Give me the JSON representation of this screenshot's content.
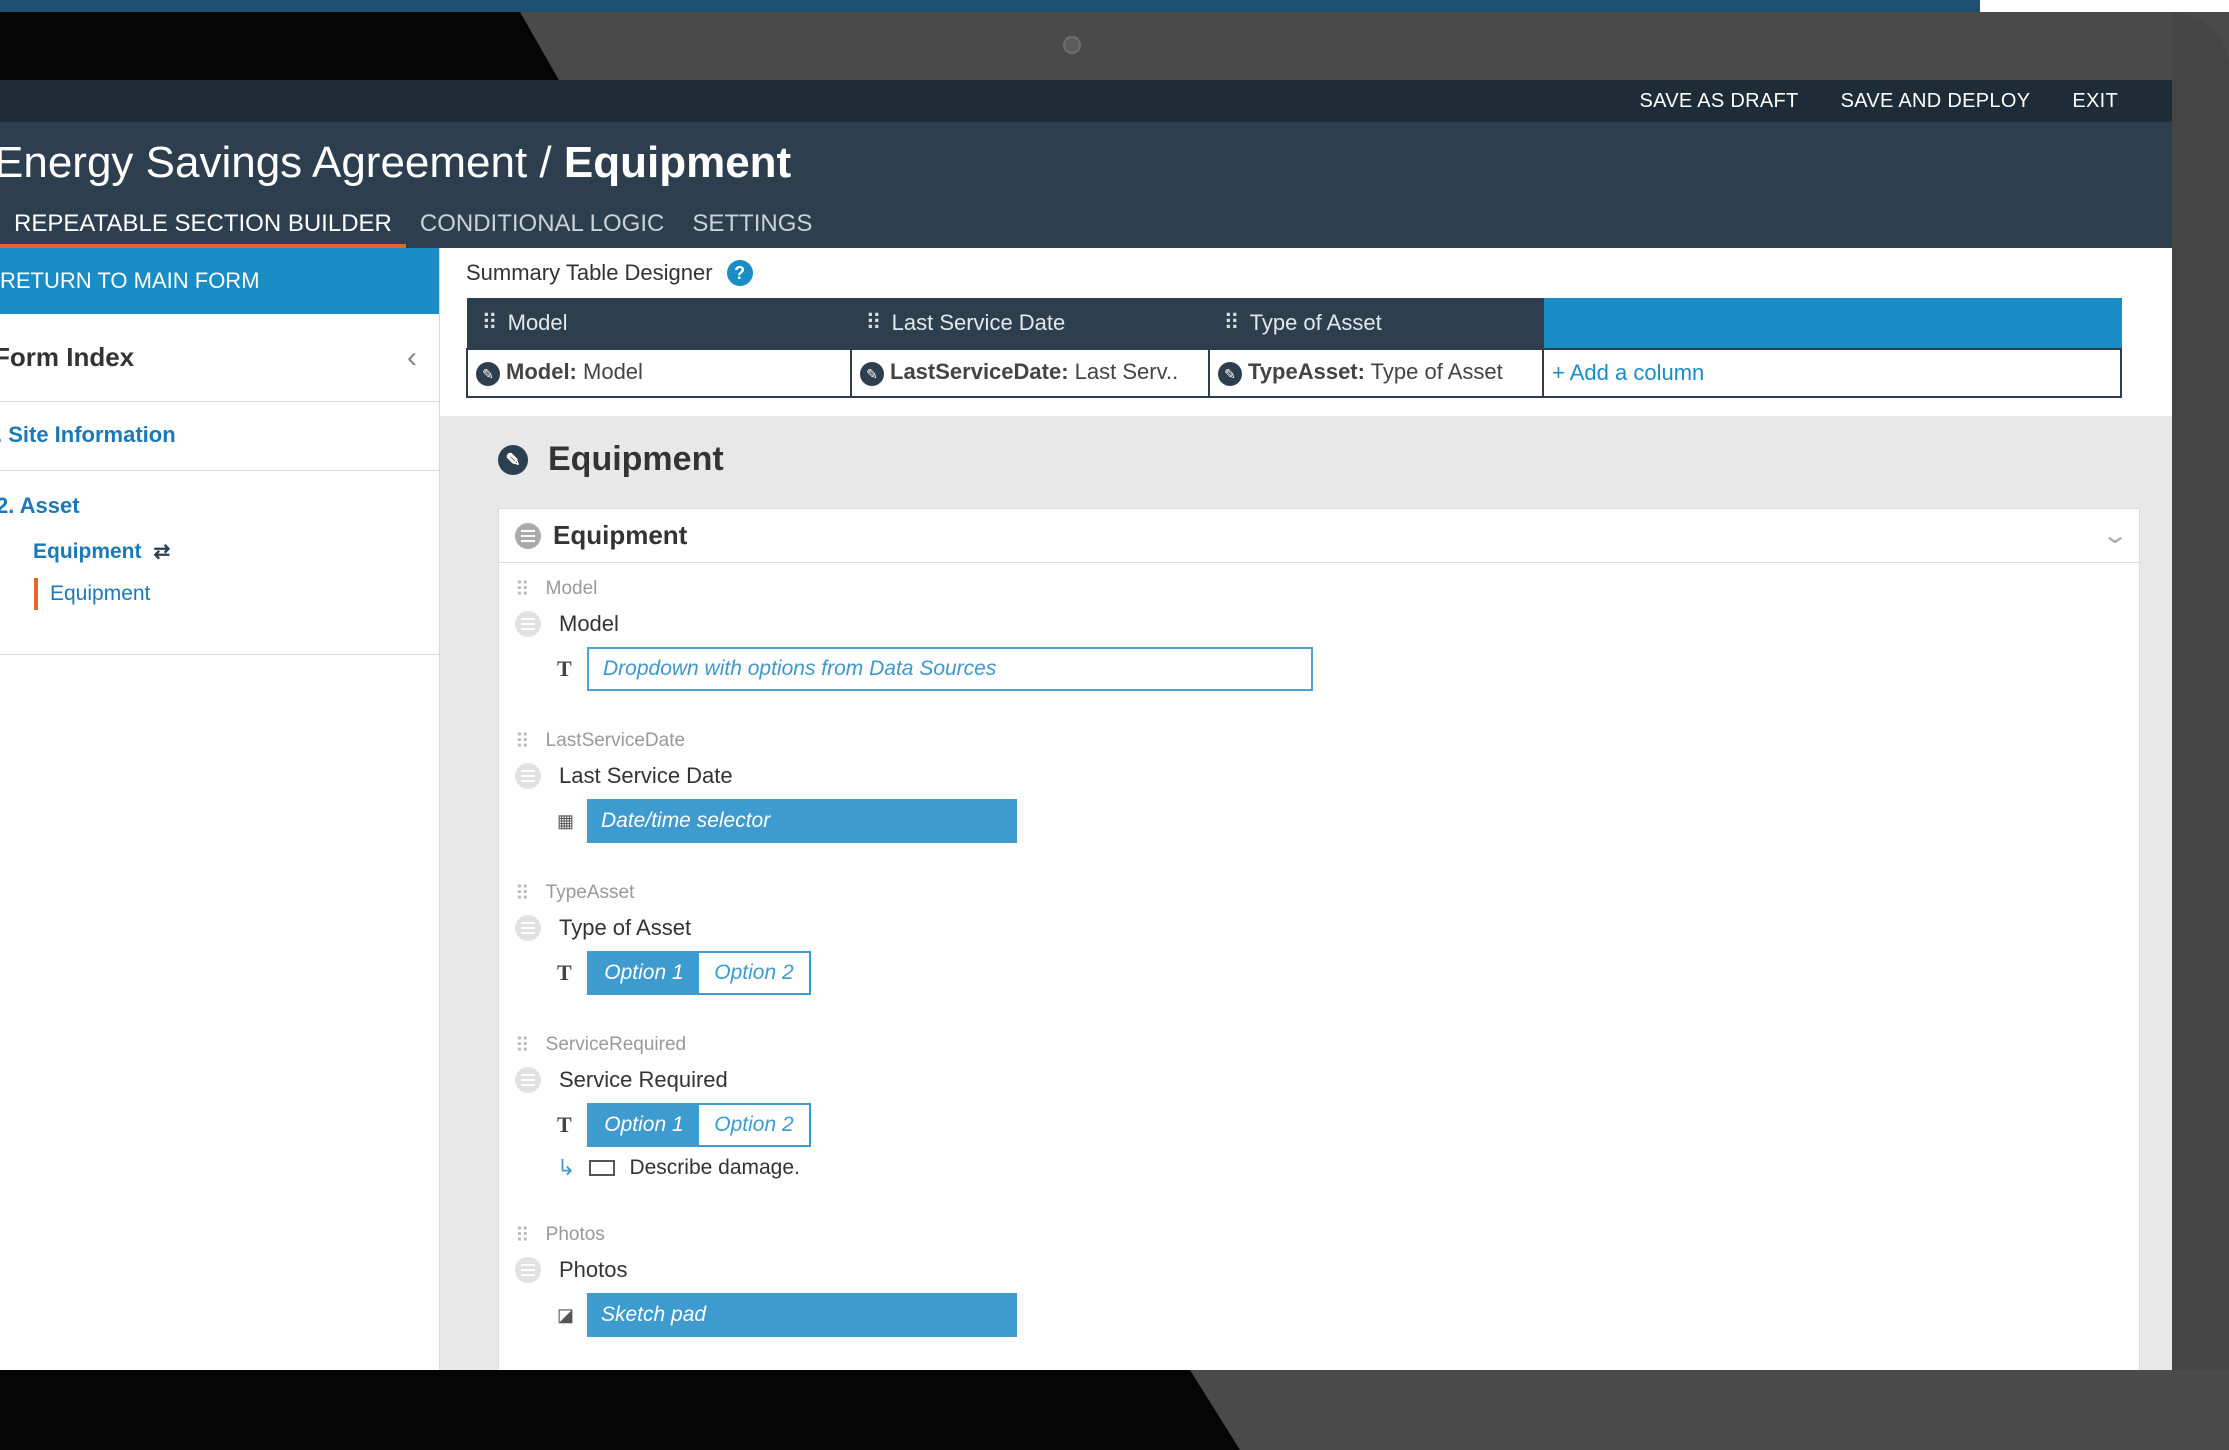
{
  "toolbar": {
    "save_draft": "SAVE AS DRAFT",
    "save_deploy": "SAVE AND DEPLOY",
    "exit": "EXIT"
  },
  "header": {
    "title_prefix": "Energy Savings Agreement / ",
    "title_bold": "Equipment"
  },
  "tabs": [
    {
      "label": "REPEATABLE SECTION BUILDER",
      "active": true
    },
    {
      "label": "CONDITIONAL LOGIC",
      "active": false
    },
    {
      "label": "SETTINGS",
      "active": false
    }
  ],
  "sidebar": {
    "return_label": "RETURN TO MAIN FORM",
    "form_index_title": "Form Index",
    "sections": [
      {
        "label": ". Site Information"
      },
      {
        "label": "2. Asset",
        "items": [
          {
            "label": "Equipment",
            "icon": "repeat-icon"
          },
          {
            "label": "Equipment",
            "active": true
          }
        ]
      }
    ]
  },
  "summary": {
    "label": "Summary Table Designer",
    "help": "?",
    "columns": [
      {
        "header": "Model",
        "key": "Model:",
        "value": " Model"
      },
      {
        "header": "Last Service Date",
        "key": "LastServiceDate:",
        "value": " Last Serv.."
      },
      {
        "header": "Type of Asset",
        "key": "TypeAsset:",
        "value": " Type of Asset"
      }
    ],
    "add_column": "+ Add a column"
  },
  "section_title": "Equipment",
  "card": {
    "title": "Equipment",
    "fields": [
      {
        "key": "Model",
        "label": "Model",
        "control": "input",
        "placeholder": "Dropdown with options from Data Sources"
      },
      {
        "key": "LastServiceDate",
        "label": "Last Service Date",
        "control": "button",
        "text": "Date/time selector"
      },
      {
        "key": "TypeAsset",
        "label": "Type of Asset",
        "control": "options",
        "options": [
          "Option 1",
          "Option 2"
        ]
      },
      {
        "key": "ServiceRequired",
        "label": "Service Required",
        "control": "options",
        "options": [
          "Option 1",
          "Option 2"
        ],
        "conditional": "Describe damage."
      },
      {
        "key": "Photos",
        "label": "Photos",
        "control": "button",
        "text": "Sketch pad"
      }
    ]
  },
  "colors": {
    "accent": "#1a8cc6",
    "header": "#2d3e4e",
    "toolbar": "#1e2c38",
    "tab_underline": "#e8642c",
    "active_nav_marker": "#e8642c"
  }
}
